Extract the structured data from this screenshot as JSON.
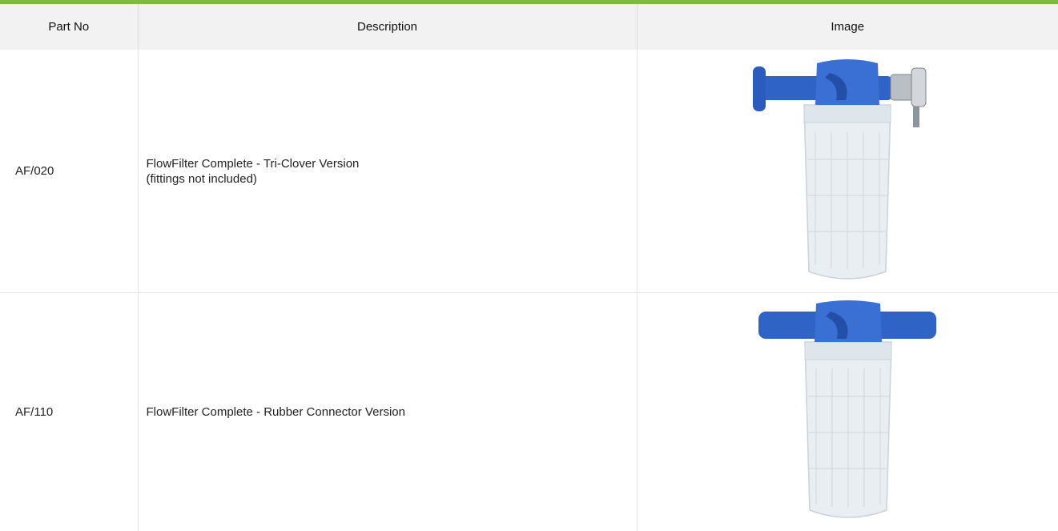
{
  "accent_color": "#7dbb3c",
  "table": {
    "headers": [
      "Part No",
      "Description",
      "Image"
    ],
    "rows": [
      {
        "part_no": "AF/020",
        "description": [
          "FlowFilter Complete - Tri-Clover Version",
          "(fittings not included)"
        ],
        "image": "flowfilter-tri-clover-photo"
      },
      {
        "part_no": "AF/110",
        "description": [
          "FlowFilter Complete - Rubber Connector Version"
        ],
        "image": "flowfilter-rubber-connector-photo"
      }
    ]
  }
}
